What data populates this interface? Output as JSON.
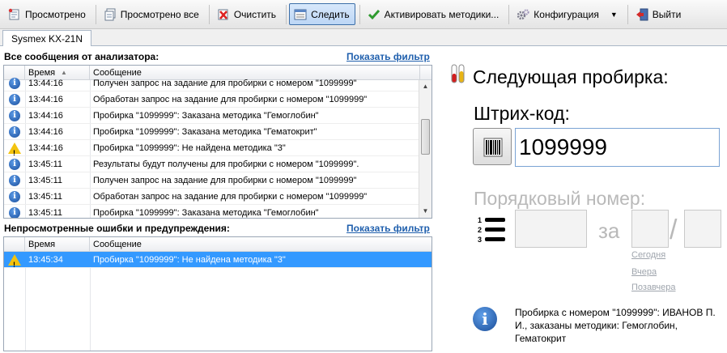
{
  "toolbar": {
    "buttons": [
      {
        "label": "Просмотрено",
        "icon": "viewed-icon"
      },
      {
        "label": "Просмотрено все",
        "icon": "viewed-all-icon"
      },
      {
        "label": "Очистить",
        "icon": "clear-icon"
      },
      {
        "label": "Следить",
        "icon": "follow-icon",
        "active": true
      },
      {
        "label": "Активировать методики...",
        "icon": "checkmark-icon"
      },
      {
        "label": "Конфигурация",
        "icon": "gear-icon"
      },
      {
        "label": "Выйти",
        "icon": "exit-icon"
      }
    ]
  },
  "tab": {
    "label": "Sysmex KX-21N"
  },
  "all_messages": {
    "title": "Все сообщения от анализатора:",
    "filter_link": "Показать фильтр",
    "columns": {
      "time": "Время",
      "message": "Сообщение"
    },
    "rows": [
      {
        "type": "info",
        "time": "13:44:16",
        "message": "Получен запрос на задание для пробирки с номером \"1099999\""
      },
      {
        "type": "info",
        "time": "13:44:16",
        "message": "Обработан запрос на задание для пробирки с номером \"1099999\""
      },
      {
        "type": "info",
        "time": "13:44:16",
        "message": "Пробирка \"1099999\": Заказана методика \"Гемоглобин\""
      },
      {
        "type": "info",
        "time": "13:44:16",
        "message": "Пробирка \"1099999\": Заказана методика \"Гематокрит\""
      },
      {
        "type": "warning",
        "time": "13:44:16",
        "message": "Пробирка \"1099999\": Не найдена методика \"3\""
      },
      {
        "type": "info",
        "time": "13:45:11",
        "message": "Результаты будут получены для пробирки с номером \"1099999\"."
      },
      {
        "type": "info",
        "time": "13:45:11",
        "message": "Получен запрос на задание для пробирки с номером \"1099999\""
      },
      {
        "type": "info",
        "time": "13:45:11",
        "message": "Обработан запрос на задание для пробирки с номером \"1099999\""
      },
      {
        "type": "info",
        "time": "13:45:11",
        "message": "Пробирка \"1099999\": Заказана методика \"Гемоглобин\""
      }
    ]
  },
  "errors": {
    "title": "Непросмотренные ошибки и предупреждения:",
    "filter_link": "Показать фильтр",
    "columns": {
      "time": "Время",
      "message": "Сообщение"
    },
    "rows": [
      {
        "type": "warning",
        "time": "13:45:34",
        "message": "Пробирка \"1099999\": Не найдена методика \"3\"",
        "selected": true
      }
    ]
  },
  "next_tube": {
    "title": "Следующая пробирка:",
    "barcode_label": "Штрих-код:",
    "barcode_value": "1099999",
    "seq_label": "Порядковый номер:",
    "for_label": "за",
    "slash": "/",
    "days": [
      "Сегодня",
      "Вчера",
      "Позавчера"
    ],
    "info_text": "Пробирка с номером \"1099999\": ИВАНОВ П. И., заказаны методики: Гемоглобин, Гематокрит"
  },
  "colors": {
    "selection": "#3399ff",
    "link": "#1f5fad",
    "warning": "#f3c30f",
    "info": "#1c4f9c"
  }
}
